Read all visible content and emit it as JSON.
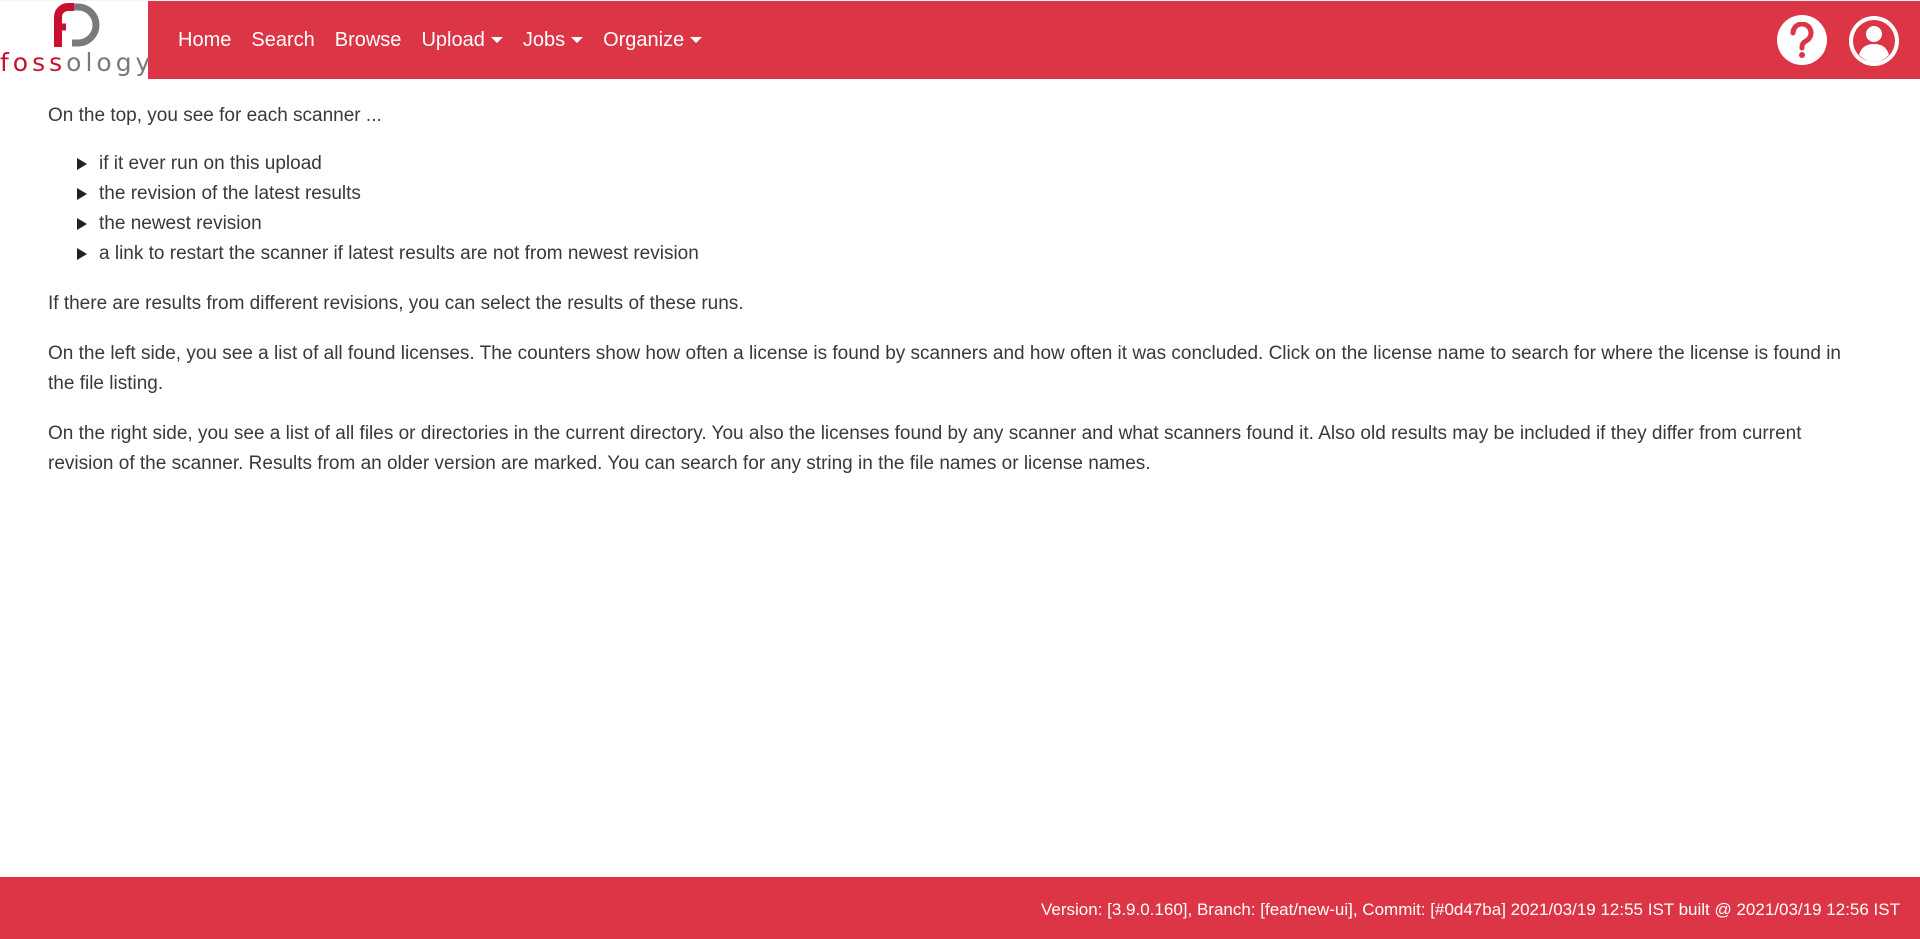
{
  "brand": {
    "logo_text_a": "foss",
    "logo_text_b": "ology",
    "color": "#dc3545"
  },
  "nav": {
    "items": [
      {
        "label": "Home",
        "dropdown": false
      },
      {
        "label": "Search",
        "dropdown": false
      },
      {
        "label": "Browse",
        "dropdown": false
      },
      {
        "label": "Upload",
        "dropdown": true
      },
      {
        "label": "Jobs",
        "dropdown": true
      },
      {
        "label": "Organize",
        "dropdown": true
      }
    ],
    "help_icon": "question-mark-icon",
    "user_icon": "user-circle-icon"
  },
  "content": {
    "intro": "On the top, you see for each scanner ...",
    "list": [
      "if it ever run on this upload",
      "the revision of the latest results",
      "the newest revision",
      "a link to restart the scanner if latest results are not from newest revision"
    ],
    "para_revisions": "If there are results from different revisions, you can select the results of these runs.",
    "para_left": "On the left side, you see a list of all found licenses. The counters show how often a license is found by scanners and how often it was concluded. Click on the license name to search for where the license is found in the file listing.",
    "para_right": "On the right side, you see a list of all files or directories in the current directory. You also the licenses found by any scanner and what scanners found it. Also old results may be included if they differ from current revision of the scanner. Results from an older version are marked. You can search for any string in the file names or license names."
  },
  "footer": {
    "version_text": "Version: [3.9.0.160], Branch: [feat/new-ui], Commit: [#0d47ba] 2021/03/19 12:55 IST built @ 2021/03/19 12:56 IST"
  }
}
